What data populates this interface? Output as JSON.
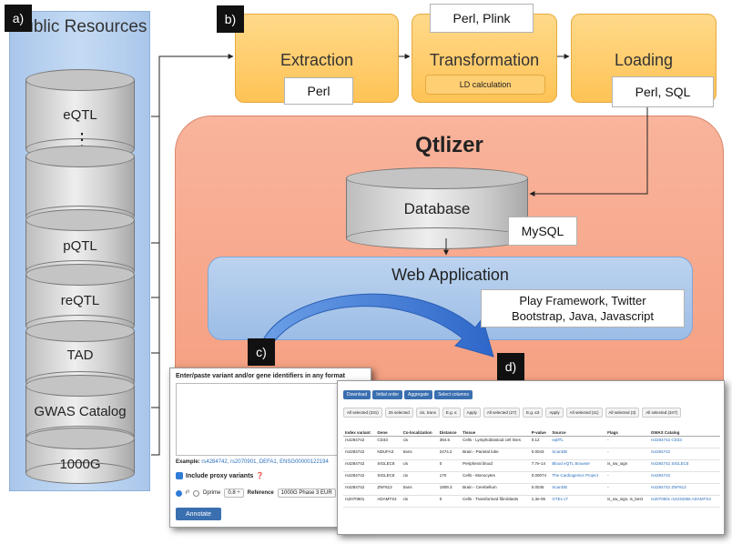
{
  "labels": {
    "a": "a)",
    "b": "b)",
    "c": "c)",
    "d": "d)"
  },
  "public_resources": {
    "title": "Public Resources",
    "items": [
      "eQTL",
      "",
      "pQTL",
      "reQTL",
      "TAD",
      "GWAS Catalog",
      "1000G"
    ],
    "ellipsis": "⋮"
  },
  "etl": {
    "extraction": {
      "title": "Extraction",
      "tech": "Perl"
    },
    "transformation": {
      "title": "Transformation",
      "tech": "Perl, Plink",
      "sub": "LD calculation"
    },
    "loading": {
      "title": "Loading",
      "tech": "Perl, SQL"
    }
  },
  "qtlizer": {
    "title": "Qtlizer",
    "database": {
      "title": "Database",
      "tech": "MySQL"
    },
    "webapp": {
      "title": "Web Application",
      "tech_line1": "Play Framework, Twitter",
      "tech_line2": "Bootstrap, Java, Javascript"
    }
  },
  "screenshot_c": {
    "header": "Enter/paste variant and/or gene identifiers in any format",
    "example_label": "Example:",
    "example_links": "rs4284742, rs2070901, DEFA1, ENSG00000122194",
    "proxy_label": "Include proxy variants",
    "r2_label": "r²",
    "dprime_label": "Dprime",
    "threshold": "0.8 ÷",
    "reference_label": "Reference",
    "reference_value": "1000G Phase 3 EUR",
    "annotate": "Annotate"
  },
  "screenshot_d": {
    "buttons": [
      "Download",
      "Initial order",
      "Aggregate",
      "Select columns"
    ],
    "filters": [
      "All selected (331)",
      "25 selected",
      "cis, trans",
      "E.g. ≤",
      "Apply",
      "All selected (27)",
      "E.g. ≤3",
      "Apply",
      "All selected (11)",
      "All selected (3)",
      "All selected (347)"
    ],
    "columns": [
      "Index variant",
      "Gene",
      "Co-localization",
      "Distance",
      "Tissue",
      "P-value",
      "Source",
      "Flags",
      "GWAS Catalog"
    ],
    "rows": [
      [
        "rs4284742",
        "CD33",
        "cis",
        "384.6",
        "Cells - Lymphoblastoid cell lines",
        "0.12",
        "eqtlTL",
        "-",
        "rs4284742 CD33"
      ],
      [
        "rs4284742",
        "NDUFA3",
        "trans",
        "2474.2",
        "Brain - Parietal lobe",
        "0.0043",
        "ScanDB",
        "-",
        "rs4284742"
      ],
      [
        "rs4284742",
        "SIGLEC8",
        "cis",
        "0",
        "Peripheral blood",
        "7.7e-14",
        "Blood eQTL Browser",
        "is_sw_sign",
        "rs4284742 SIGLEC8"
      ],
      [
        "rs4284742",
        "SIGLEC8",
        "cis",
        "170",
        "Cells - Monocytes",
        "0.00074",
        "The Cardiogenics Project",
        "-",
        "rs4284742"
      ],
      [
        "rs4284742",
        "ZNF813",
        "trans",
        "1809.3",
        "Brain - Cerebellum",
        "0.0045",
        "ScanDB",
        "-",
        "rs4284742 ZNF813"
      ],
      [
        "rs2070901",
        "ADAMTS4",
        "cis",
        "0",
        "Cells - Transformed fibroblasts",
        "1.3e-05",
        "GTEx v7",
        "is_sw_sign, is_best",
        "rs2070901 rs4233366 ADAMTS4"
      ]
    ]
  },
  "colors": {
    "etl_fill": "#ffc355",
    "qtlizer_fill": "#f49b7c",
    "webapp_fill": "#9cbde6",
    "public_fill": "#b8d1f0",
    "arrow_blue": "#3d7ad6"
  }
}
